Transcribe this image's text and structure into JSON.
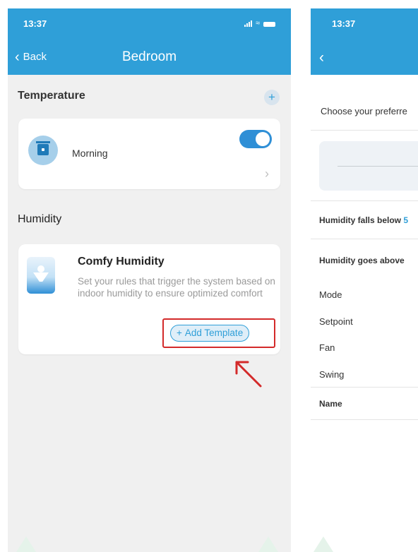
{
  "left_screen": {
    "status_time": "13:37",
    "back_label": "Back",
    "title": "Bedroom",
    "temperature_section": {
      "title": "Temperature",
      "add_symbol": "+"
    },
    "temperature_schedule": {
      "name": "Morning",
      "enabled": true,
      "icon": "schedule-icon"
    },
    "humidity_section": {
      "title": "Humidity"
    },
    "humidity_template": {
      "name": "Comfy Humidity",
      "description": "Set your rules that trigger the system based on indoor humidity to ensure optimized comfort",
      "add_button_label": "Add Template",
      "add_button_symbol": "+",
      "icon": "person-comfort-icon"
    },
    "annotation_color": "#d32a2a"
  },
  "right_screen": {
    "status_time": "13:37",
    "subtitle": "Choose your preferre",
    "rule_falls_below": "Humidity falls below",
    "rule_falls_below_value": "5",
    "rule_goes_above": "Humidity goes above",
    "fields": [
      "Mode",
      "Setpoint",
      "Fan",
      "Swing"
    ],
    "name_label": "Name"
  },
  "colors": {
    "accent": "#2f9fd8",
    "toggle": "#2f8fd6",
    "background": "#f0f0f0"
  }
}
